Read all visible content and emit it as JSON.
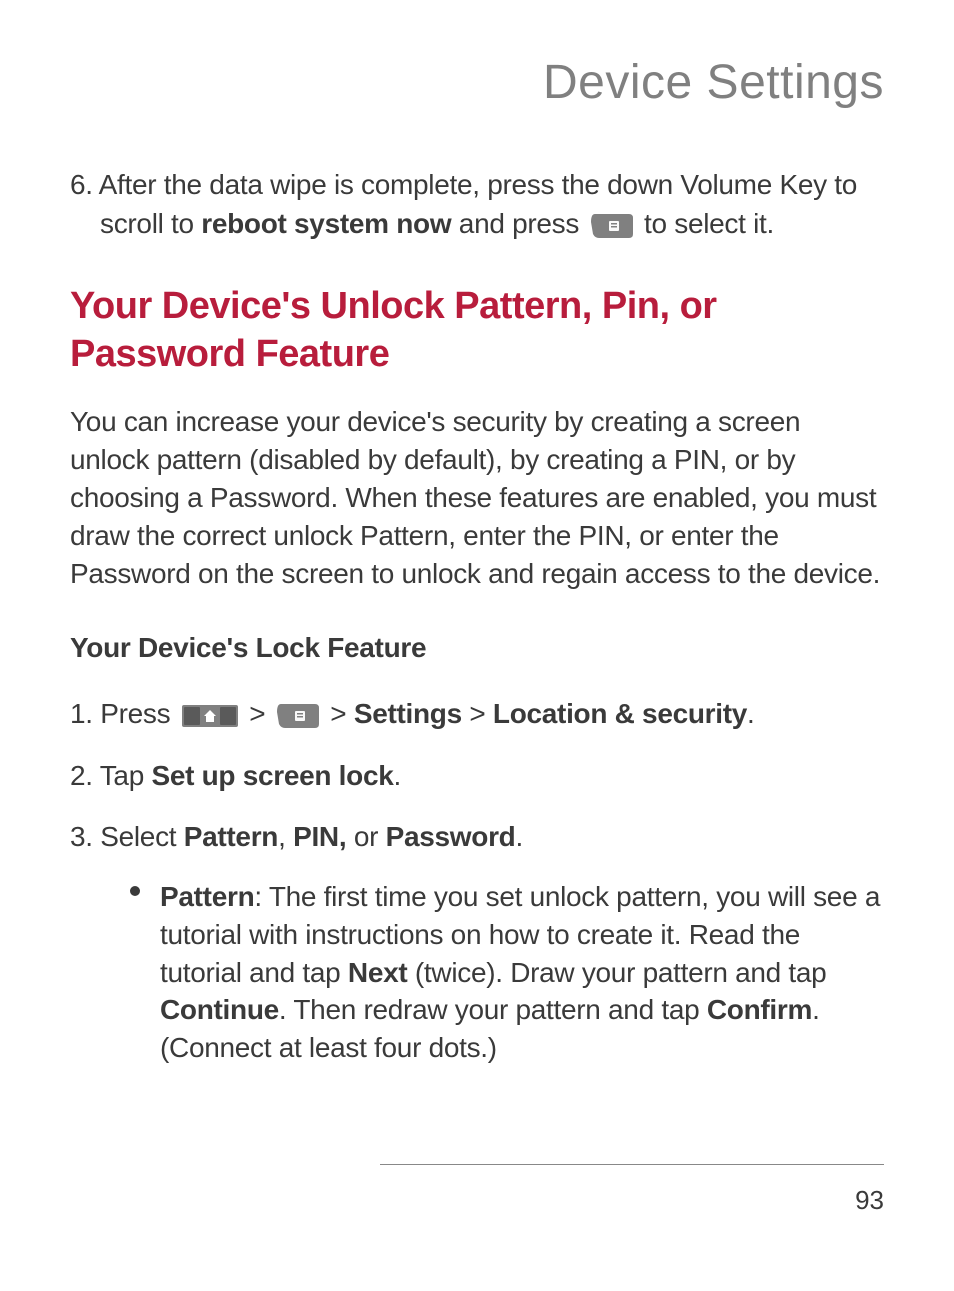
{
  "header": {
    "title": "Device Settings"
  },
  "step6": {
    "line1_prefix": "6. After the data wipe is complete, press the down Volume Key to",
    "line2_prefix": "scroll to ",
    "line2_bold": "reboot system now",
    "line2_mid": " and press ",
    "line2_suffix": " to select it."
  },
  "section": {
    "heading": "Your Device's Unlock Pattern, Pin, or Password Feature",
    "intro": "You can increase your device's security by creating a screen unlock pattern (disabled by default), by creating a PIN, or by choosing a Password. When these features are enabled, you must draw the correct unlock Pattern, enter the PIN, or enter the Password on the screen to unlock and regain access to the device."
  },
  "lock_feature": {
    "heading": "Your Device's Lock Feature",
    "step1": {
      "prefix": "1. Press ",
      "sep": " > ",
      "settings": "Settings",
      "sep2": " > ",
      "location": "Location & security",
      "end": "."
    },
    "step2": {
      "prefix": "2. Tap ",
      "bold": "Set up screen lock",
      "end": "."
    },
    "step3": {
      "prefix": "3. Select ",
      "b1": "Pattern",
      "c1": ", ",
      "b2": "PIN,",
      "c2": " or ",
      "b3": "Password",
      "end": "."
    },
    "bullet": {
      "b_pattern": "Pattern",
      "t1": ": The first time you set unlock pattern, you will see a tutorial with instructions on how to create it. Read the tutorial and tap ",
      "b_next": "Next",
      "t2": " (twice). Draw your pattern and tap ",
      "b_continue": "Continue",
      "t3": ". Then redraw your pattern and tap ",
      "b_confirm": "Confirm",
      "t4": ". (Connect at least four dots.)"
    }
  },
  "footer": {
    "page_number": "93"
  }
}
